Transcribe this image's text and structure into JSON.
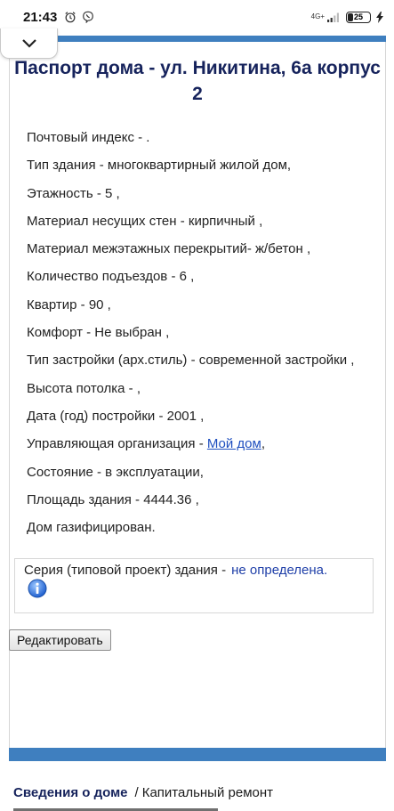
{
  "statusbar": {
    "time": "21:43",
    "network": "4G+",
    "battery": "25",
    "battery_level": 0.25,
    "icons": [
      "alarm-icon",
      "viber-icon",
      "signal-icon",
      "charging-icon"
    ]
  },
  "collapse_icon": "chevron-down-icon",
  "title": "Паспорт дома - ул. Никитина, 6а корпус 2",
  "properties": [
    "Почтовый индекс - .",
    "Тип здания - многоквартирный жилой дом,",
    "Этажность - 5 ,",
    "Материал несущих стен - кирпичный ,",
    "Материал межэтажных перекрытий- ж/бетон ,",
    "Количество подъездов - 6 ,",
    "Квартир - 90 ,",
    "Комфорт - Не выбран ,",
    "Тип застройки (арх.стиль) - современной застройки ,",
    "Высота потолка - ,",
    "Дата (год) постройки - 2001 ,"
  ],
  "management": {
    "label": "Управляющая организация - ",
    "link": "Мой дом",
    "suffix": ","
  },
  "properties_after": [
    "Состояние - в эксплуатации,",
    "Площадь здания - 4444.36 ,",
    "Дом газифицирован."
  ],
  "series": {
    "label": "Серия (типовой проект) здания -",
    "value": "не определена."
  },
  "edit_button": "Редактировать",
  "breadcrumb": {
    "active": "Сведения о доме",
    "separator": "/",
    "item": "Капитальный ремонт"
  },
  "colors": {
    "accent_blue": "#3f7fbf",
    "title_navy": "#16235c",
    "link_blue": "#1f4fbf"
  }
}
